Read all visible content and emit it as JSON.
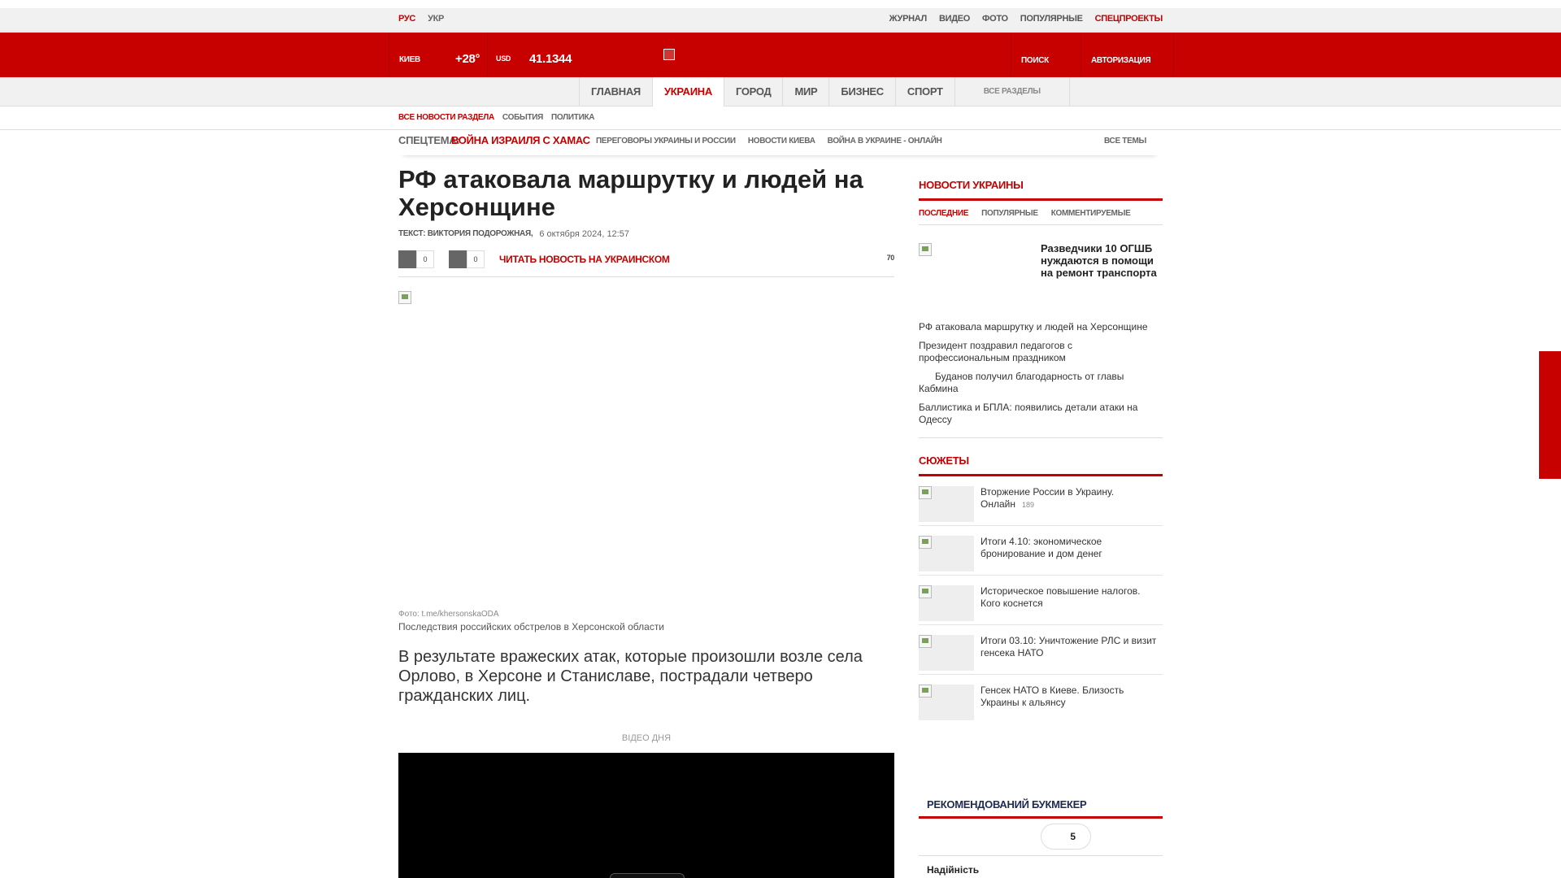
{
  "topbar": {
    "lang": [
      "РУС",
      "УКР"
    ],
    "links": [
      "ЖУРНАЛ",
      "ВИДЕО",
      "ФОТО",
      "ПОПУЛЯРНЫЕ",
      "СПЕЦПРОЕКТЫ"
    ]
  },
  "header": {
    "city": "КИЕВ",
    "temp": "+28°",
    "currency": "USD",
    "rate": "41.1344",
    "search": "ПОИСК",
    "auth": "АВТОРИЗАЦИЯ"
  },
  "nav": {
    "items": [
      "ГЛАВНАЯ",
      "УКРАИНА",
      "ГОРОД",
      "МИР",
      "БИЗНЕС",
      "СПОРТ"
    ],
    "all": "ВСЕ РАЗДЕЛЫ"
  },
  "subnav": [
    "ВСЕ НОВОСТИ РАЗДЕЛА",
    "СОБЫТИЯ",
    "ПОЛИТИКА"
  ],
  "spec": {
    "label": "СПЕЦТЕМА:",
    "theme": "ВОЙНА ИЗРАИЛЯ С ХАМАС",
    "links": [
      "ПЕРЕГОВОРЫ УКРАИНЫ И РОССИИ",
      "НОВОСТИ КИЕВА",
      "ВОЙНА В УКРАИНЕ - ОНЛАЙН"
    ],
    "all": "ВСЕ ТЕМЫ"
  },
  "article": {
    "title": "РФ атаковала маршрутку и людей на Херсонщине",
    "author_label": "ТЕКСТ:",
    "author": "ВИКТОРИЯ ПОДОРОЖНАЯ",
    "date": "6 октября 2024, 12:57",
    "share1_count": "0",
    "share2_count": "0",
    "read_ua": "ЧИТАТЬ НОВОСТЬ НА УКРАИНСКОМ",
    "views": "70",
    "photo_credit": "Фото: t.me/khersonskaODA",
    "photo_caption": "Последствия российских обстрелов в Херсонской области",
    "lead": "В результате вражеских атак, которые произошли возле села Орлово, в Херсоне и Станиславе, пострадали четверо гражданских лиц.",
    "video_label": "ВІДЕО ДНЯ"
  },
  "sidebar": {
    "news_title": "НОВОСТИ УКРАИНЫ",
    "tabs": [
      "ПОСЛЕДНИЕ",
      "ПОПУЛЯРНЫЕ",
      "КОММЕНТИРУЕМЫЕ"
    ],
    "featured": "Разведчики 10 ОГШБ нуждаются в помощи на ремонт транспорта",
    "news": [
      "РФ атаковала маршрутку и людей на Херсонщине",
      "Президент поздравил педагогов с профессиональным праздником",
      "Буданов получил благодарность от главы Кабмина",
      "Баллистика и БПЛА: появились детали атаки на Одессу"
    ],
    "stories_title": "СЮЖЕТЫ",
    "stories": [
      {
        "title": "Вторжение России в Украину. Онлайн",
        "count": "189"
      },
      {
        "title": "Итоги 4.10: экономическое бронирование и дом денег",
        "count": ""
      },
      {
        "title": "Историческое повышение налогов. Кого коснется",
        "count": ""
      },
      {
        "title": "Итоги 03.10: Уничтожение РЛС и визит генсека НАТО",
        "count": ""
      },
      {
        "title": "Генсек НАТО в Киеве. Близость Украины к альянсу",
        "count": ""
      }
    ],
    "bookmaker_title": "РЕКОМЕНДОВАНИЙ БУКМЕКЕР",
    "bookmaker_rating": "5",
    "bookmaker_label": "Надійність"
  }
}
